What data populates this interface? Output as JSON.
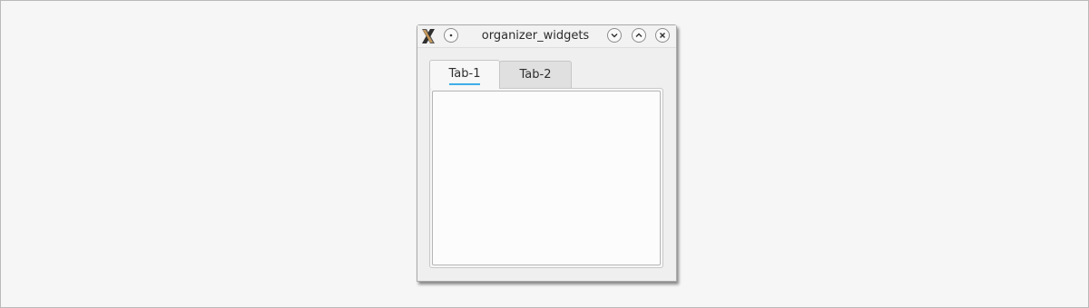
{
  "window": {
    "title": "organizer_widgets",
    "icons": {
      "app": "x-app-icon",
      "menu": "window-menu-icon",
      "minimize": "chevron-down-icon",
      "maximize": "chevron-up-icon",
      "close": "close-icon"
    }
  },
  "tabs": [
    {
      "label": "Tab-1",
      "active": true
    },
    {
      "label": "Tab-2",
      "active": false
    }
  ],
  "colors": {
    "desktop": "#f6f6f6",
    "window_bg": "#efefef",
    "active_tab_indicator": "#3daee9"
  }
}
